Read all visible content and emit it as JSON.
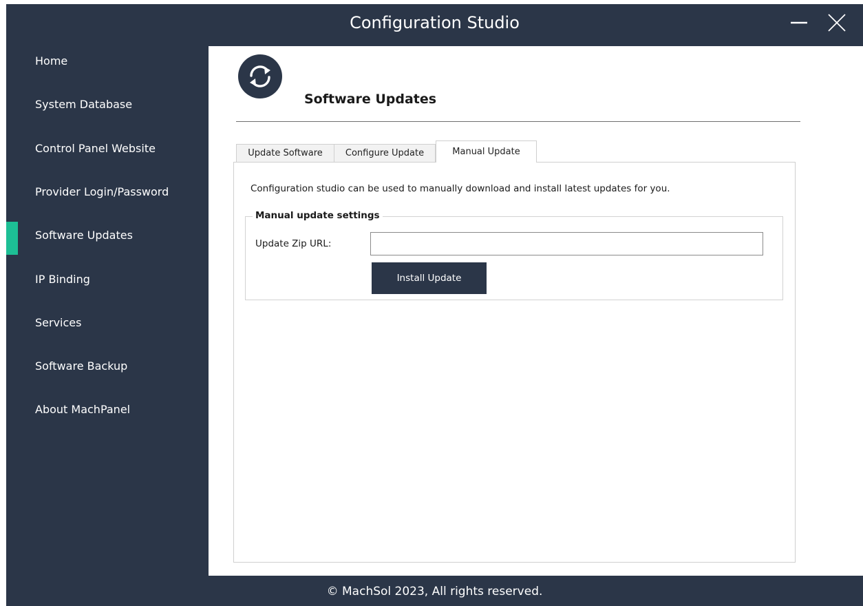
{
  "window": {
    "title": "Configuration Studio",
    "minimize_icon": "minimize-icon",
    "close_icon": "close-icon"
  },
  "sidebar": {
    "items": [
      {
        "label": "Home"
      },
      {
        "label": "System Database"
      },
      {
        "label": "Control Panel Website"
      },
      {
        "label": "Provider Login/Password"
      },
      {
        "label": "Software Updates",
        "active": true
      },
      {
        "label": "IP Binding"
      },
      {
        "label": "Services"
      },
      {
        "label": "Software Backup"
      },
      {
        "label": "About MachPanel"
      }
    ]
  },
  "header": {
    "icon": "sync-icon",
    "title": "Software Updates"
  },
  "tabs": [
    {
      "label": "Update Software"
    },
    {
      "label": "Configure Update"
    },
    {
      "label": "Manual Update",
      "selected": true
    }
  ],
  "manual_update": {
    "description": "Configuration studio can be used to manually download and install latest updates for you.",
    "group_title": "Manual update settings",
    "url_label": "Update Zip URL:",
    "url_value": "",
    "install_button": "Install Update"
  },
  "footer": {
    "copyright": "© MachSol 2023, All rights reserved."
  },
  "colors": {
    "sidebar_bg": "#2b3648",
    "accent": "#1dbf95",
    "button_bg": "#2b3648"
  }
}
